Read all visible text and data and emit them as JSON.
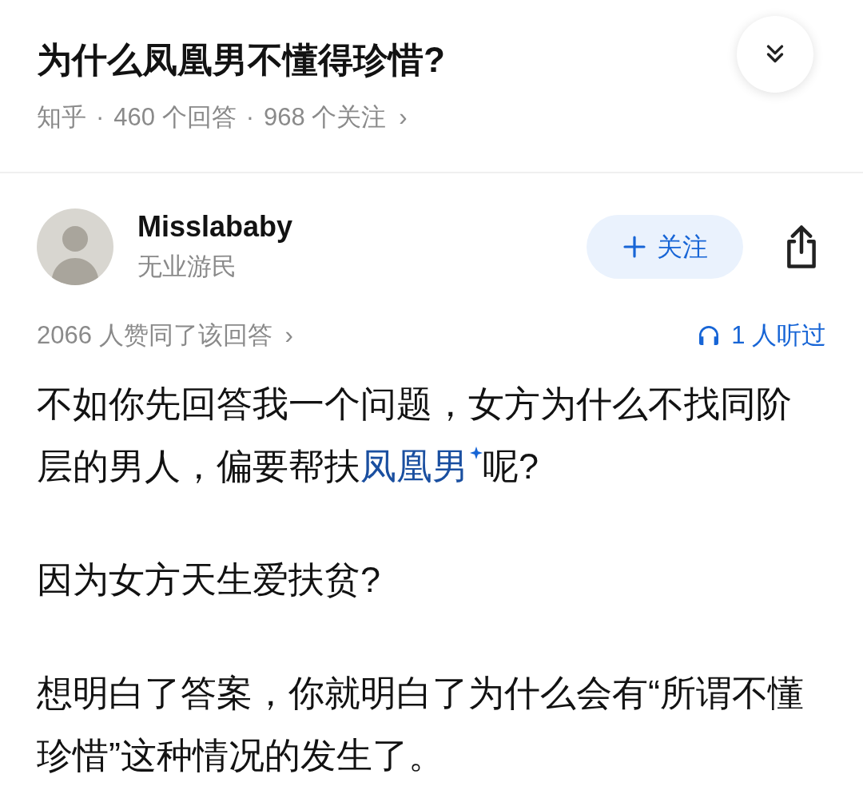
{
  "question": {
    "title": "为什么凤凰男不懂得珍惜?",
    "meta": [
      "知乎",
      "460 个回答",
      "968 个关注"
    ],
    "chevron": "›",
    "separator": "·"
  },
  "author": {
    "name": "Misslababy",
    "bio": "无业游民",
    "follow_label": "关注",
    "followed": false
  },
  "answer_stats": {
    "upvotes": "2066 人赞同了该回答",
    "listened": "1 人听过"
  },
  "paragraphs": [
    [
      {
        "kind": "text",
        "text": "不如你先回答我一个问题，女方为什么不找同阶层的男人，偏要帮扶"
      },
      {
        "kind": "link",
        "text": "凤凰男"
      },
      {
        "kind": "text",
        "text": "呢?"
      }
    ],
    [
      {
        "kind": "text",
        "text": "因为女方天生爱扶贫?"
      }
    ],
    [
      {
        "kind": "text",
        "text": "想明白了答案，你就明白了为什么会有“所谓不懂珍惜”这种情况的发生了。"
      }
    ]
  ]
}
